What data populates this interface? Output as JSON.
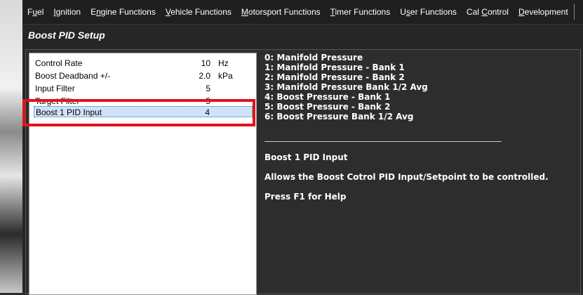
{
  "menu": {
    "items": [
      {
        "pre": "F",
        "ul": "u",
        "post": "el"
      },
      {
        "pre": "",
        "ul": "I",
        "post": "gnition"
      },
      {
        "pre": "E",
        "ul": "n",
        "post": "gine Functions"
      },
      {
        "pre": "",
        "ul": "V",
        "post": "ehicle Functions"
      },
      {
        "pre": "",
        "ul": "M",
        "post": "otorsport Functions"
      },
      {
        "pre": "",
        "ul": "T",
        "post": "imer Functions"
      },
      {
        "pre": "U",
        "ul": "s",
        "post": "er Functions"
      },
      {
        "pre": "Cal ",
        "ul": "C",
        "post": "ontrol"
      },
      {
        "pre": "",
        "ul": "D",
        "post": "evelopment"
      }
    ]
  },
  "window": {
    "title": "Boost PID Setup"
  },
  "params": [
    {
      "label": "Control Rate",
      "value": "10",
      "unit": "Hz"
    },
    {
      "label": "Boost Deadband +/-",
      "value": "2.0",
      "unit": "kPa"
    },
    {
      "label": "Input Filter",
      "value": "5",
      "unit": ""
    },
    {
      "label": "Target Filter",
      "value": "5",
      "unit": ""
    },
    {
      "label": "Boost 1 PID Input",
      "value": "4",
      "unit": ""
    }
  ],
  "info": {
    "options": [
      "0: Manifold Pressure",
      "1: Manifold Pressure - Bank 1",
      "2: Manifold Pressure - Bank 2",
      "3: Manifold Pressure Bank 1/2 Avg",
      "4: Boost Pressure - Bank 1",
      "5: Boost Pressure - Bank 2",
      "6: Boost Pressure Bank 1/2 Avg"
    ],
    "help_title": "Boost 1 PID Input",
    "help_description": "Allows the Boost Cotrol PID Input/Setpoint to be controlled.",
    "help_hint": "Press F1 for Help"
  },
  "colors": {
    "highlight": "#e3111b",
    "selected_row": "#cfe3f7"
  }
}
